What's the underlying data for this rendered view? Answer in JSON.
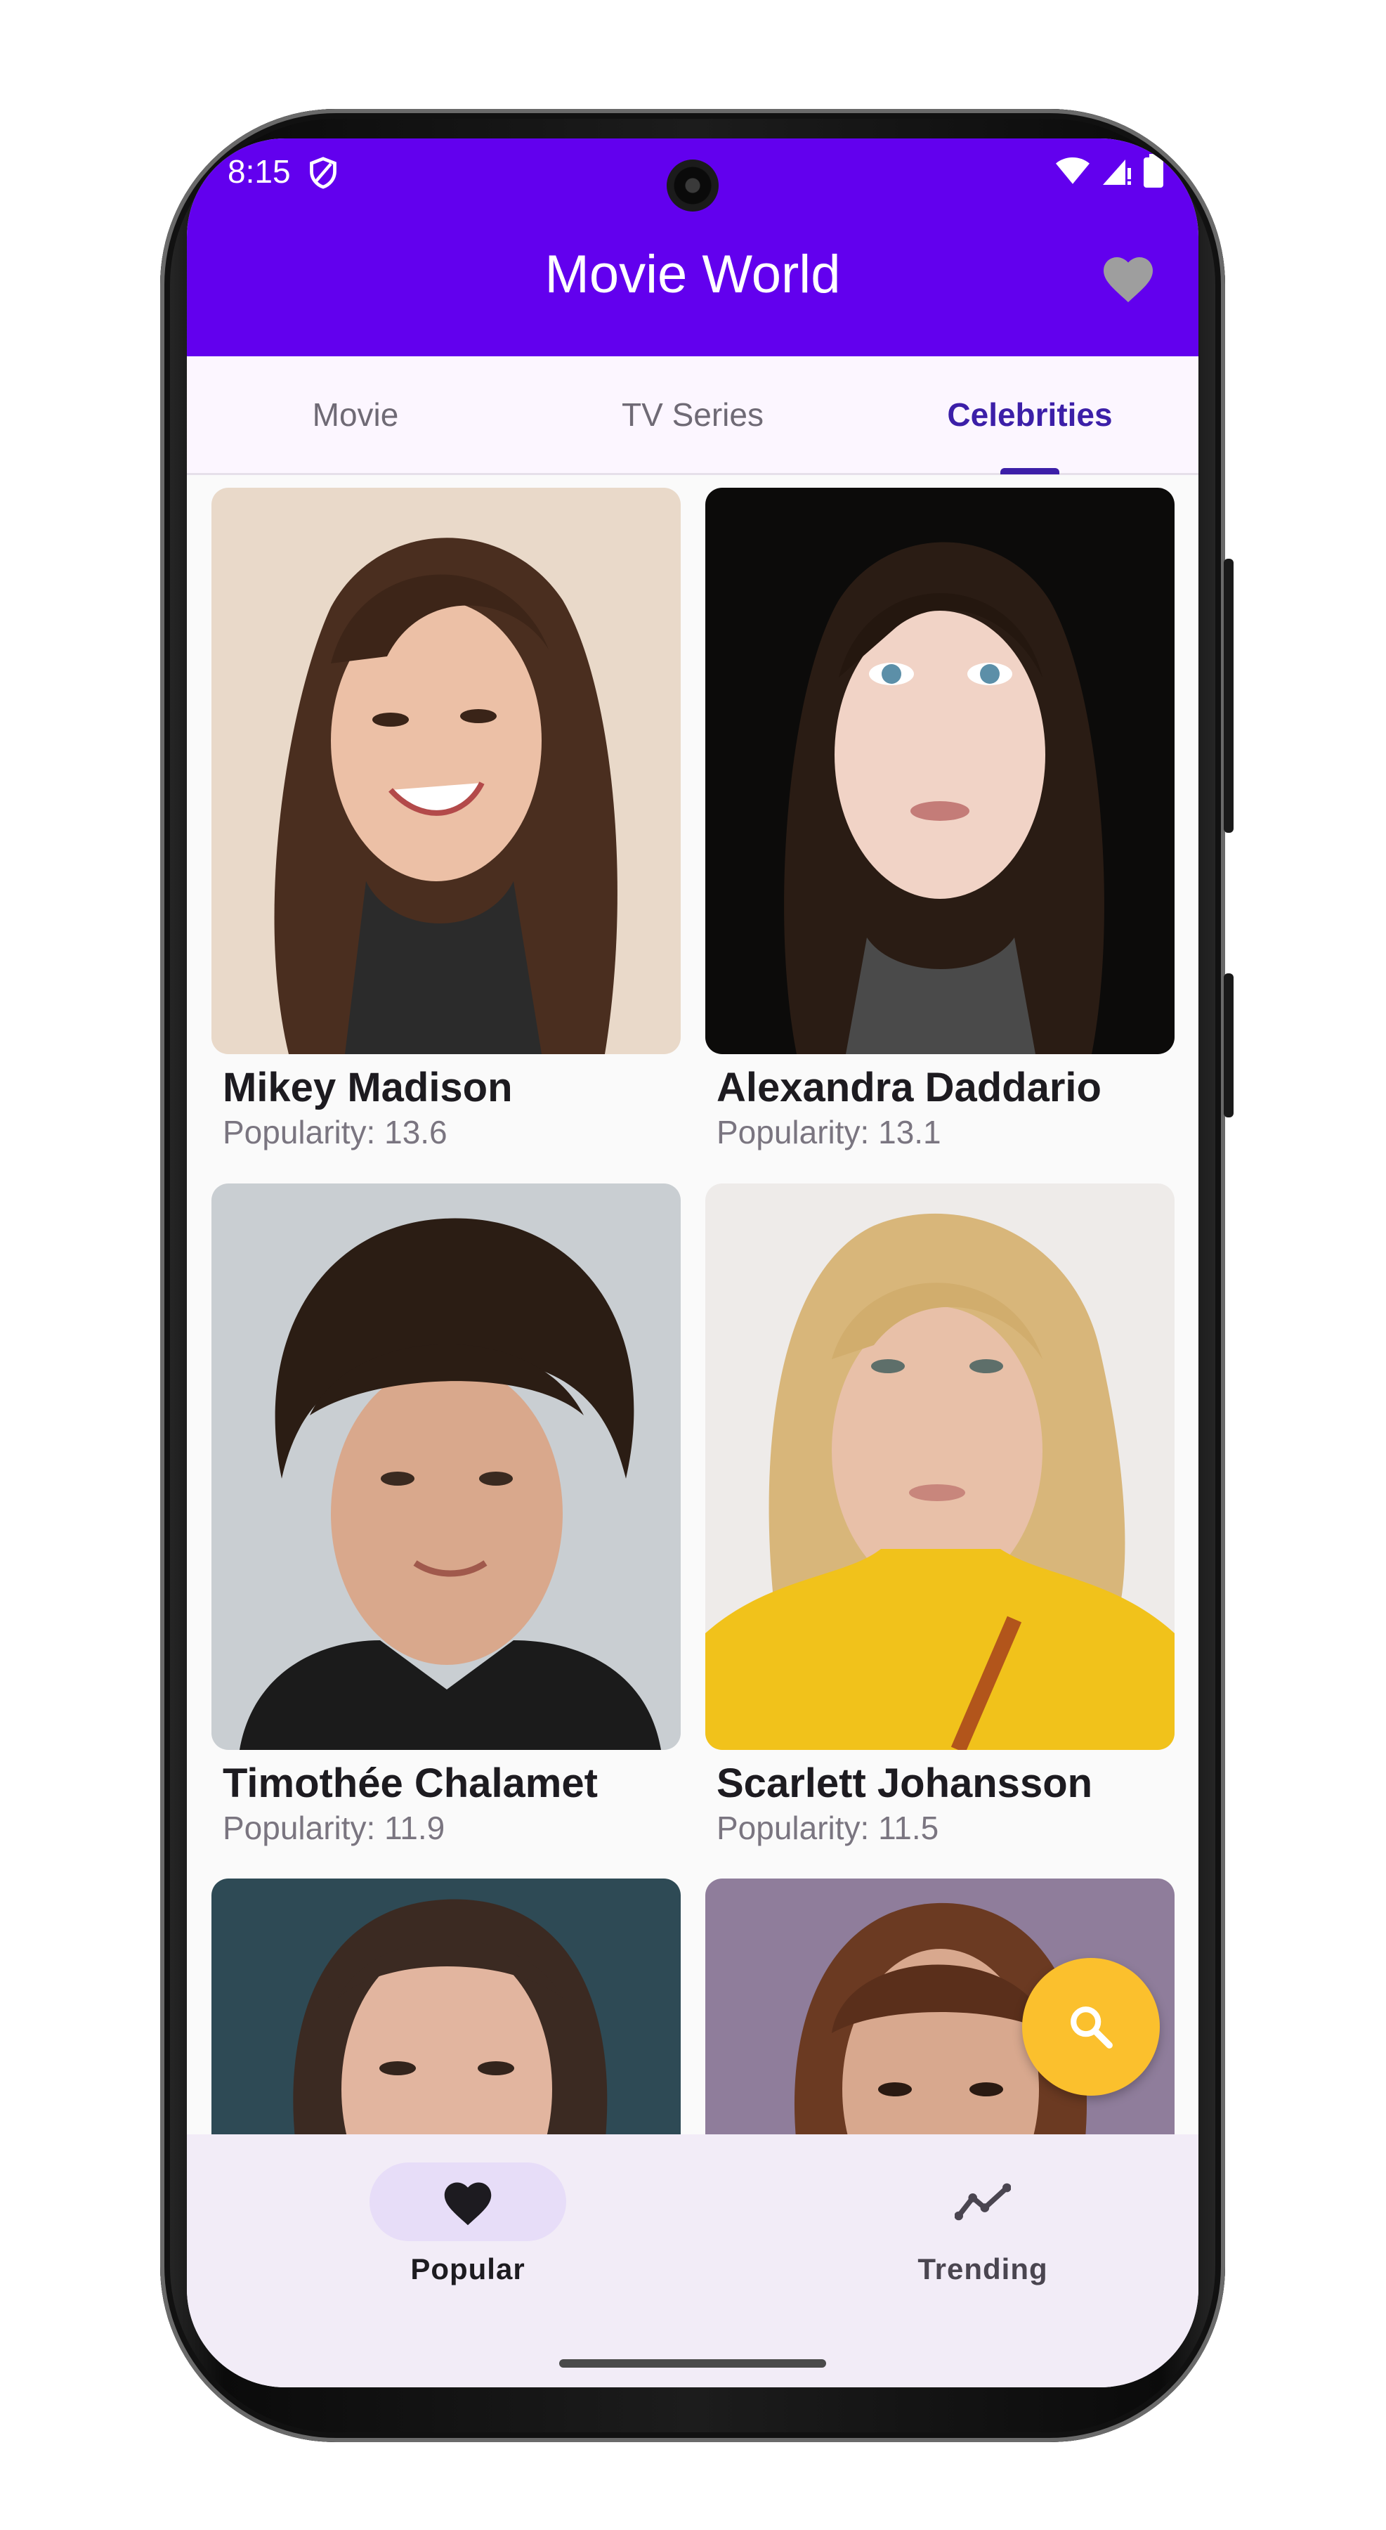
{
  "status_bar": {
    "time": "8:15"
  },
  "app_bar": {
    "title": "Movie World",
    "favorite_icon": "heart-icon"
  },
  "tabs": [
    {
      "label": "Movie",
      "active": false
    },
    {
      "label": "TV Series",
      "active": false
    },
    {
      "label": "Celebrities",
      "active": true
    }
  ],
  "celebrities": [
    {
      "name": "Mikey Madison",
      "popularity": "Popularity: 13.6"
    },
    {
      "name": "Alexandra Daddario",
      "popularity": "Popularity: 13.1"
    },
    {
      "name": "Timothée Chalamet",
      "popularity": "Popularity: 11.9"
    },
    {
      "name": "Scarlett Johansson",
      "popularity": "Popularity: 11.5"
    }
  ],
  "fab": {
    "icon": "search-icon",
    "color": "#fbc02d"
  },
  "bottom_nav": [
    {
      "label": "Popular",
      "icon": "heart-icon",
      "active": true
    },
    {
      "label": "Trending",
      "icon": "trending-icon",
      "active": false
    }
  ],
  "colors": {
    "primary": "#6200ee",
    "accent": "#fbc02d",
    "tab_active": "#3c1fa8"
  }
}
